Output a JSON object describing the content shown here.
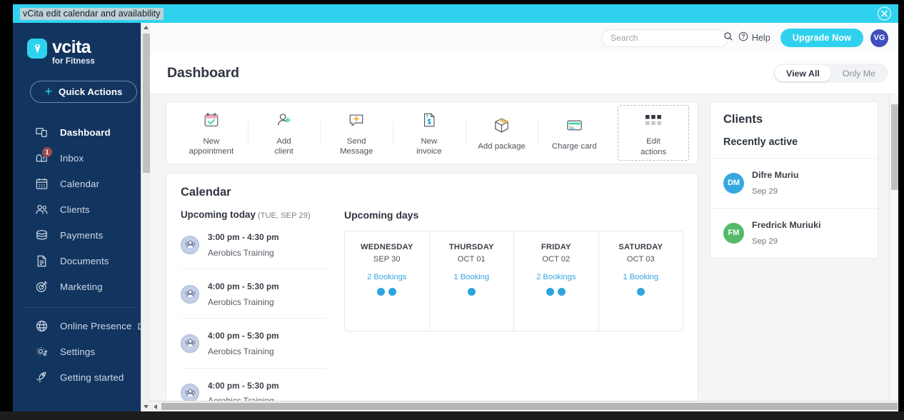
{
  "window": {
    "title": "vCita edit calendar and availability",
    "close_icon": "close-circle-icon"
  },
  "sidebar": {
    "brand": {
      "name": "vcita",
      "subtitle": "for Fitness",
      "logo_icon": "vcita-logo-icon"
    },
    "quick_actions": {
      "label": "Quick Actions",
      "plus_icon": "plus-icon"
    },
    "items": [
      {
        "label": "Dashboard",
        "icon": "dashboard-icon",
        "active": true
      },
      {
        "label": "Inbox",
        "icon": "inbox-icon",
        "badge": "1"
      },
      {
        "label": "Calendar",
        "icon": "calendar-icon"
      },
      {
        "label": "Clients",
        "icon": "clients-icon"
      },
      {
        "label": "Payments",
        "icon": "payments-icon"
      },
      {
        "label": "Documents",
        "icon": "documents-icon"
      },
      {
        "label": "Marketing",
        "icon": "marketing-icon"
      }
    ],
    "items_secondary": [
      {
        "label": "Online Presence",
        "icon": "globe-icon",
        "external": true
      },
      {
        "label": "Settings",
        "icon": "gear-icon"
      },
      {
        "label": "Getting started",
        "icon": "rocket-icon"
      }
    ]
  },
  "topbar": {
    "search": {
      "placeholder": "Search",
      "value": "",
      "icon": "search-icon"
    },
    "help": {
      "label": "Help",
      "icon": "question-circle-icon"
    },
    "upgrade": {
      "label": "Upgrade Now"
    },
    "avatar": {
      "initials": "VG",
      "color": "#3f4fbf"
    }
  },
  "page": {
    "title": "Dashboard",
    "filter": {
      "options": [
        "View All",
        "Only Me"
      ],
      "selected": "View All"
    }
  },
  "quick_actions_bar": {
    "items": [
      {
        "label": "New\nappointment",
        "line1": "New",
        "line2": "appointment",
        "icon": "calendar-check-icon"
      },
      {
        "label": "Add client",
        "line1": "Add",
        "line2": "client",
        "icon": "add-person-icon"
      },
      {
        "label": "Send Message",
        "line1": "Send",
        "line2": "Message",
        "icon": "message-plus-icon"
      },
      {
        "label": "New invoice",
        "line1": "New",
        "line2": "invoice",
        "icon": "invoice-icon"
      },
      {
        "label": "Add package",
        "line1": "Add package",
        "line2": "",
        "icon": "package-icon"
      },
      {
        "label": "Charge card",
        "line1": "Charge card",
        "line2": "",
        "icon": "credit-card-icon"
      },
      {
        "label": "Edit actions",
        "line1": "Edit",
        "line2": "actions",
        "icon": "grid-dots-icon"
      }
    ]
  },
  "calendar": {
    "title": "Calendar",
    "upcoming_today": {
      "heading": "Upcoming today",
      "date": "(TUE, SEP 29)"
    },
    "appointments": [
      {
        "time": "3:00 pm - 4:30 pm",
        "name": "Aerobics Training",
        "icon": "group-avatar-icon"
      },
      {
        "time": "4:00 pm - 5:30 pm",
        "name": "Aerobics Training",
        "icon": "group-avatar-icon"
      },
      {
        "time": "4:00 pm - 5:30 pm",
        "name": "Aerobics Training",
        "icon": "group-avatar-icon"
      },
      {
        "time": "4:00 pm - 5:30 pm",
        "name": "Aerobics Training",
        "icon": "group-avatar-icon"
      }
    ],
    "upcoming_days": {
      "heading": "Upcoming days",
      "days": [
        {
          "day": "WEDNESDAY",
          "date": "SEP 30",
          "bookings_label": "2 Bookings",
          "bookings": 2
        },
        {
          "day": "THURSDAY",
          "date": "OCT 01",
          "bookings_label": "1 Booking",
          "bookings": 1
        },
        {
          "day": "FRIDAY",
          "date": "OCT 02",
          "bookings_label": "2 Bookings",
          "bookings": 2
        },
        {
          "day": "SATURDAY",
          "date": "OCT 03",
          "bookings_label": "1 Booking",
          "bookings": 1
        }
      ]
    }
  },
  "clients": {
    "title": "Clients",
    "subtitle": "Recently active",
    "list": [
      {
        "name": "Difre Muriu",
        "date": "Sep 29",
        "initials": "DM",
        "color": "#35a8e0"
      },
      {
        "name": "Fredrick Muriuki",
        "date": "Sep 29",
        "initials": "FM",
        "color": "#55b96a"
      }
    ]
  },
  "colors": {
    "titlebar": "#2fd2ee",
    "sidebar": "#123560",
    "accent": "#2fd2ee",
    "link": "#37a5e0"
  }
}
